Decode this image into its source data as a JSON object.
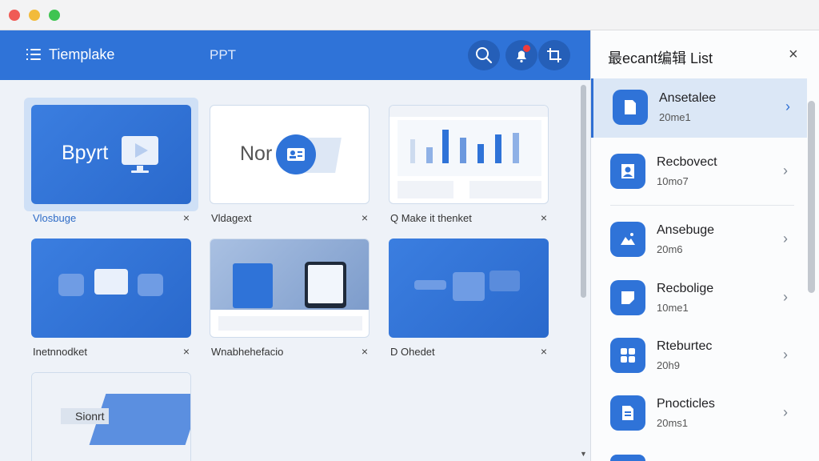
{
  "window": {
    "controls": [
      "close",
      "minimize",
      "maximize"
    ]
  },
  "header": {
    "title": "Tiemplake",
    "section": "PPT",
    "buttons": [
      {
        "icon": "search-icon"
      },
      {
        "icon": "bell-icon",
        "has_badge": true
      },
      {
        "icon": "crop-icon"
      }
    ]
  },
  "grid": {
    "cards": [
      {
        "caption": "Vlosbuge",
        "thumb_text": "Bpyrt",
        "style": "blue",
        "selected": true
      },
      {
        "caption": "Vldagext",
        "thumb_text": "Nor",
        "style": "white",
        "selected": false
      },
      {
        "caption": "Q Make it  thenket",
        "thumb_text": "",
        "style": "white",
        "selected": false
      },
      {
        "caption": "Inetnnodket",
        "thumb_text": "",
        "style": "blue",
        "selected": false
      },
      {
        "caption": "Wnabhehefacio",
        "thumb_text": "",
        "style": "white",
        "selected": false
      },
      {
        "caption": "D Ohedet",
        "thumb_text": "",
        "style": "blue",
        "selected": false
      },
      {
        "caption": "",
        "thumb_text": "Sionrt",
        "style": "white",
        "selected": false
      }
    ],
    "close_glyph": "×"
  },
  "panel": {
    "title": "最ecant编辑  List",
    "close_glyph": "×",
    "items": [
      {
        "name": "Ansetalee",
        "time": "20me1",
        "icon": "document-icon",
        "active": true
      },
      {
        "name": "Recbovect",
        "time": "10mo7",
        "icon": "user-icon",
        "active": false
      },
      {
        "name": "Ansebuge",
        "time": "20m6",
        "icon": "image-icon",
        "active": false
      },
      {
        "name": "Recbolige",
        "time": "10me1",
        "icon": "note-icon",
        "active": false
      },
      {
        "name": "Rteburtec",
        "time": "20h9",
        "icon": "grid-icon",
        "active": false
      },
      {
        "name": "Pnocticles",
        "time": "20ms1",
        "icon": "file-text-icon",
        "active": false
      }
    ]
  },
  "colors": {
    "accent": "#2f73d8",
    "header_bg": "#2f73d8",
    "active_row": "#dbe7f6"
  }
}
